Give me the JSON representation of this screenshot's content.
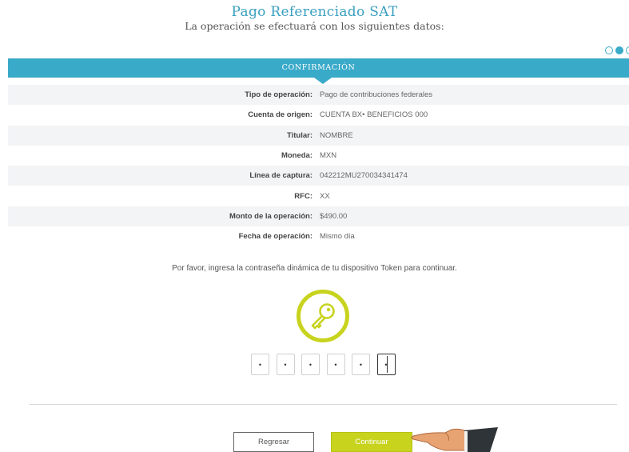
{
  "header": {
    "title": "Pago Referenciado SAT",
    "subtitle": "La operación se efectuará con los siguientes datos:"
  },
  "section": {
    "label": "CONFIRMACIÓN"
  },
  "details": [
    {
      "label": "Tipo de operación:",
      "value": "Pago de contribuciones federales"
    },
    {
      "label": "Cuenta de origen:",
      "value": "CUENTA BX• BENEFICIOS 000"
    },
    {
      "label": "Titular:",
      "value": "NOMBRE"
    },
    {
      "label": "Moneda:",
      "value": "MXN"
    },
    {
      "label": "Línea de captura:",
      "value": "042212MU270034341474"
    },
    {
      "label": "RFC:",
      "value": "XX"
    },
    {
      "label": "Monto de la operación:",
      "value": "$490.00"
    },
    {
      "label": "Fecha de operación:",
      "value": "Mismo día"
    }
  ],
  "token": {
    "prompt": "Por favor, ingresa la contraseña dinámica de tu dispositivo Token para continuar.",
    "digits": [
      "•",
      "•",
      "•",
      "•",
      "•",
      "•"
    ]
  },
  "buttons": {
    "back": "Regresar",
    "continue": "Continuar"
  },
  "colors": {
    "accent": "#3aaac9",
    "lime": "#c8d31d"
  },
  "icons": {
    "token": "key-icon",
    "pointer": "pointing-hand-icon"
  }
}
